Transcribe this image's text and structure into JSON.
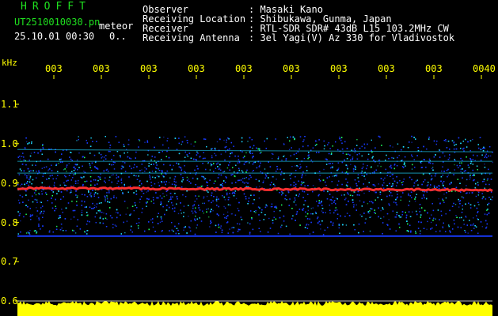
{
  "app": {
    "brand": "HROFFT",
    "filename": "UT2510010030.pn",
    "tag": "meteor",
    "datetime": "25.10.01 00:30",
    "count": "0.."
  },
  "info": {
    "rows": [
      {
        "label": "Observer",
        "value": ": Masaki Kano"
      },
      {
        "label": "Receiving Location",
        "value": ": Shibukawa, Gunma, Japan"
      },
      {
        "label": "Receiver",
        "value": ": RTL-SDR SDR# 43dB L15 103.2MHz CW"
      },
      {
        "label": "Receiving Antenna",
        "value": ": 3el Yagi(V) Az 330 for Vladivostok"
      }
    ]
  },
  "axis": {
    "unit": "kHz",
    "y_ticks": [
      "1.1",
      "1.0",
      "0.9",
      "0.8",
      "0.7",
      "0.6"
    ],
    "x_ticks": [
      "003",
      "003",
      "003",
      "003",
      "003",
      "003",
      "003",
      "003",
      "003",
      "0040"
    ]
  },
  "colors": {
    "axis_text": "#ffff00",
    "info_text": "#ffffff",
    "brand_text": "#1fe11f",
    "background": "#000000",
    "echo_line": "#ff3030",
    "noise_blue": "#1a3cff",
    "noise_cyan": "#20d8ff",
    "noise_green": "#20ff60",
    "level_bar": "#ffff00"
  },
  "spectrogram": {
    "noise_band_khz": [
      0.77,
      1.02
    ],
    "echo_line_khz": [
      0.887,
      0.882
    ],
    "faint_lines_khz": [
      0.985,
      0.955,
      0.925,
      0.765
    ],
    "signal_level_band_khz": [
      0.585,
      0.6
    ]
  }
}
